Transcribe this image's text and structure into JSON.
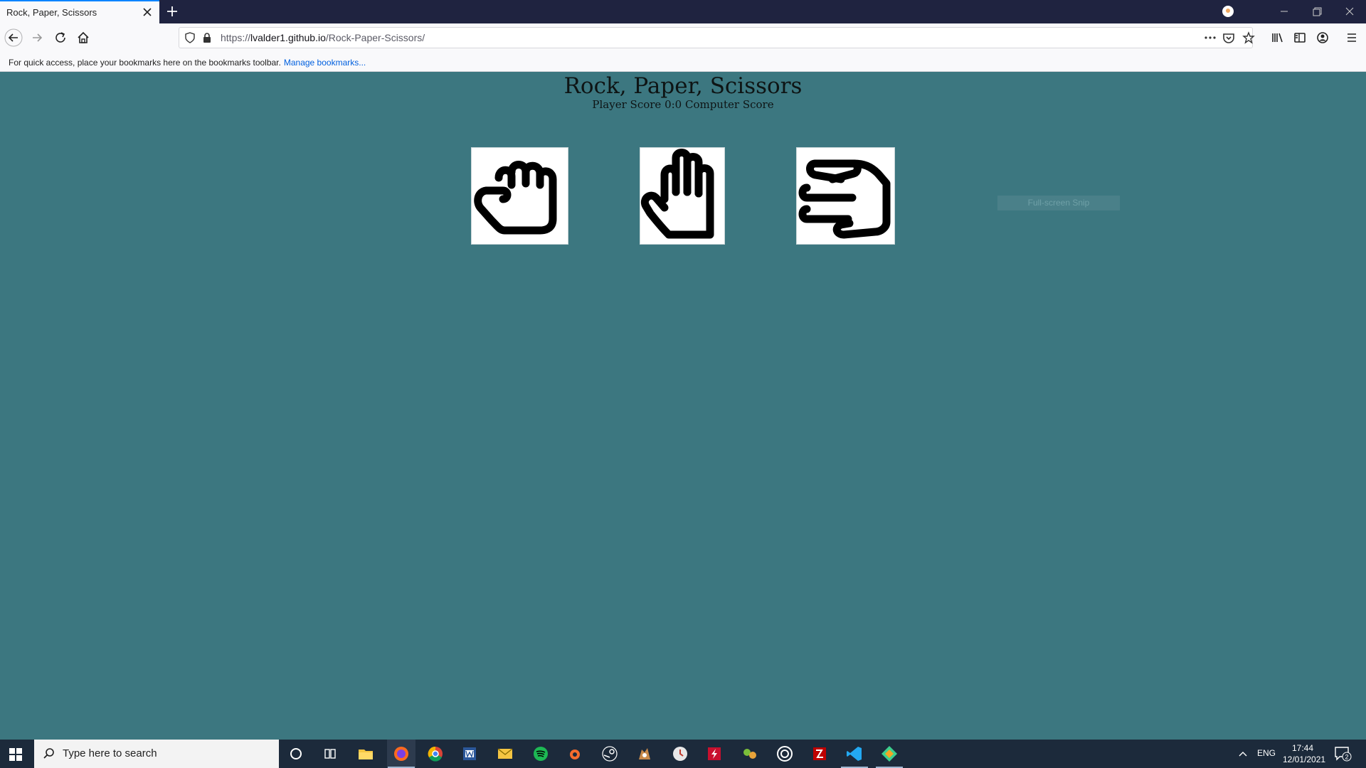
{
  "browser": {
    "tab_title": "Rock, Paper, Scissors",
    "url_prefix": "https://",
    "url_host": "lvalder1.github.io",
    "url_path": "/Rock-Paper-Scissors/",
    "bookmarks_message": "For quick access, place your bookmarks here on the bookmarks toolbar.",
    "bookmarks_link": "Manage bookmarks..."
  },
  "game": {
    "title": "Rock, Paper, Scissors",
    "score_line": "Player Score 0:0 Computer Score",
    "choices": [
      {
        "name": "rock",
        "icon": "fist-icon"
      },
      {
        "name": "paper",
        "icon": "open-hand-icon"
      },
      {
        "name": "scissors",
        "icon": "scissors-hand-icon"
      }
    ]
  },
  "overlay": {
    "snip_label": "Full-screen Snip"
  },
  "taskbar": {
    "search_placeholder": "Type here to search",
    "language": "ENG",
    "time": "17:44",
    "date": "12/01/2021",
    "notification_count": "2"
  },
  "colors": {
    "page_background": "#3c7780",
    "tab_accent": "#0a84ff",
    "link": "#0060df"
  }
}
